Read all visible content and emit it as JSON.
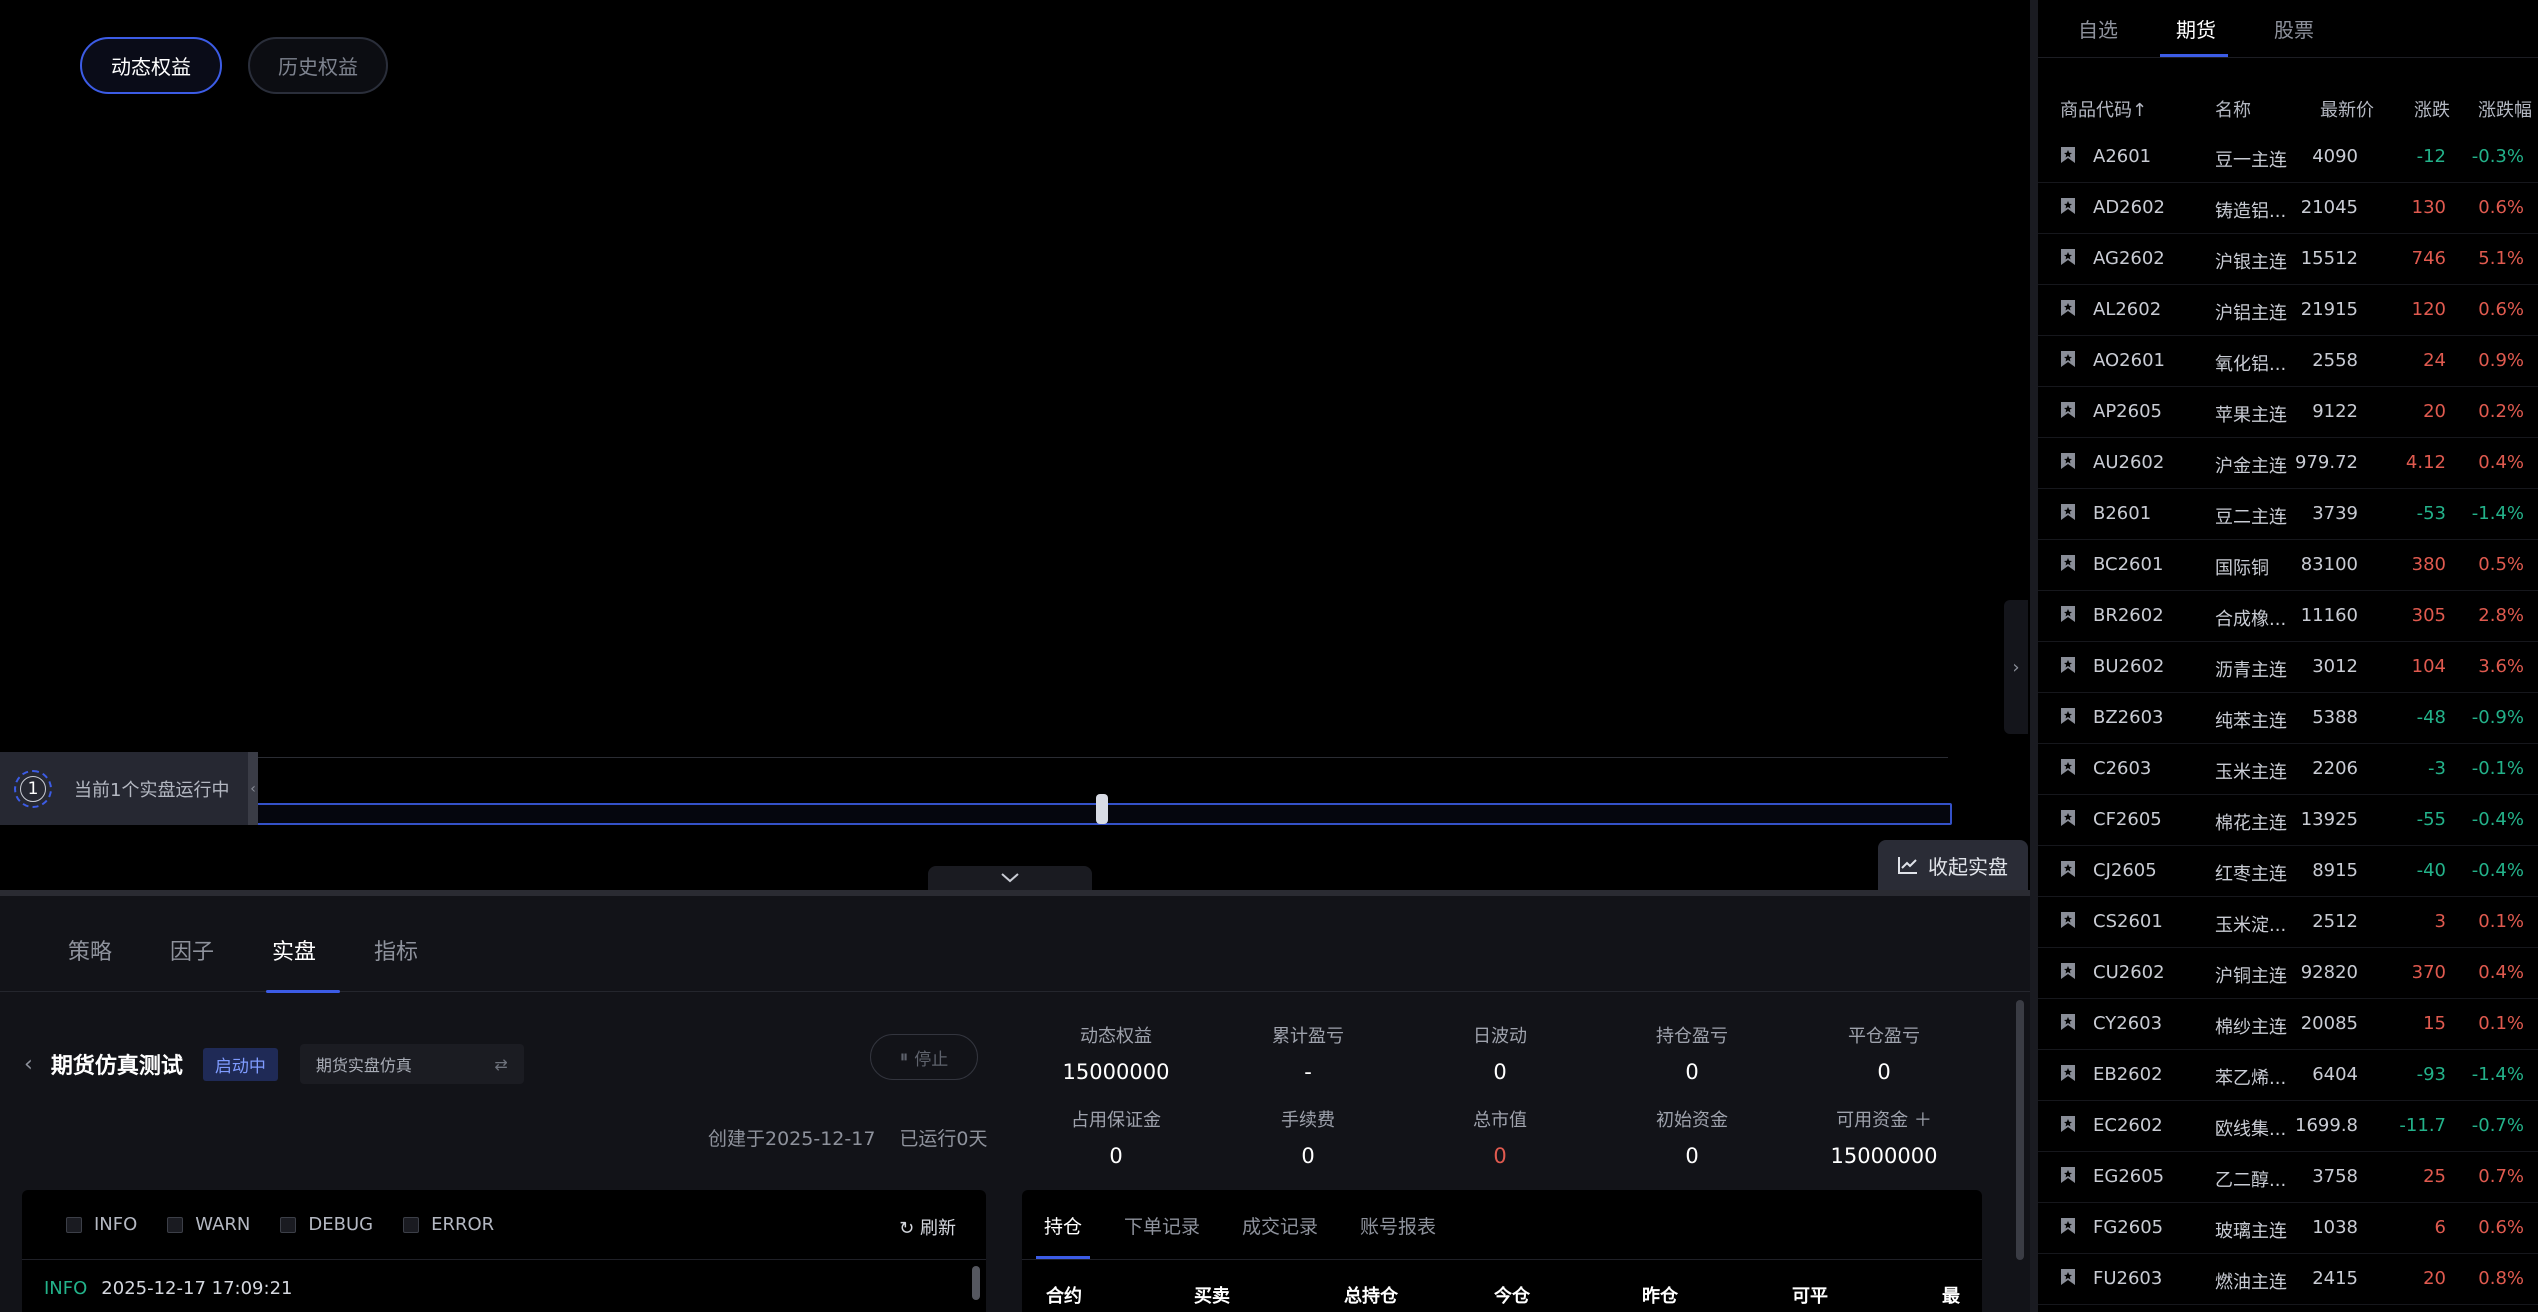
{
  "equity_toggle": {
    "dynamic": "动态权益",
    "history": "历史权益"
  },
  "running_info": {
    "count": "1",
    "text": "当前1个实盘运行中"
  },
  "collapse_button": "收起实盘",
  "bottom_tabs": [
    "策略",
    "因子",
    "实盘",
    "指标"
  ],
  "strategy": {
    "name": "期货仿真测试",
    "status": "启动中",
    "mode": "期货实盘仿真",
    "stop_label": "停止",
    "created": "创建于2025-12-17",
    "running_days": "已运行0天"
  },
  "stats": [
    {
      "label": "动态权益",
      "value": "15000000"
    },
    {
      "label": "累计盈亏",
      "value": "-"
    },
    {
      "label": "日波动",
      "value": "0"
    },
    {
      "label": "持仓盈亏",
      "value": "0"
    },
    {
      "label": "平仓盈亏",
      "value": "0"
    },
    {
      "label": "占用保证金",
      "value": "0"
    },
    {
      "label": "手续费",
      "value": "0"
    },
    {
      "label": "总市值",
      "value": "0",
      "color": "#e05a4f"
    },
    {
      "label": "初始资金",
      "value": "0"
    },
    {
      "label": "可用资金 ＋",
      "value": "15000000"
    }
  ],
  "log": {
    "filters": [
      "INFO",
      "WARN",
      "DEBUG",
      "ERROR"
    ],
    "refresh": "刷新",
    "entries": [
      {
        "level": "INFO",
        "time": "2025-12-17 17:09:21"
      }
    ]
  },
  "positions": {
    "tabs": [
      "持仓",
      "下单记录",
      "成交记录",
      "账号报表"
    ],
    "columns": [
      "合约",
      "买卖",
      "总持仓",
      "今仓",
      "昨仓",
      "可平",
      "最新"
    ]
  },
  "market": {
    "tabs": [
      "自选",
      "期货",
      "股票"
    ],
    "headers": [
      "商品代码↑",
      "名称",
      "最新价",
      "涨跌",
      "涨跌幅"
    ],
    "rows": [
      {
        "code": "A2601",
        "name": "豆一主连",
        "price": "4090",
        "change": "-12",
        "pct": "-0.3%",
        "dir": "down"
      },
      {
        "code": "AD2602",
        "name": "铸造铝...",
        "price": "21045",
        "change": "130",
        "pct": "0.6%",
        "dir": "up"
      },
      {
        "code": "AG2602",
        "name": "沪银主连",
        "price": "15512",
        "change": "746",
        "pct": "5.1%",
        "dir": "up"
      },
      {
        "code": "AL2602",
        "name": "沪铝主连",
        "price": "21915",
        "change": "120",
        "pct": "0.6%",
        "dir": "up"
      },
      {
        "code": "AO2601",
        "name": "氧化铝...",
        "price": "2558",
        "change": "24",
        "pct": "0.9%",
        "dir": "up"
      },
      {
        "code": "AP2605",
        "name": "苹果主连",
        "price": "9122",
        "change": "20",
        "pct": "0.2%",
        "dir": "up"
      },
      {
        "code": "AU2602",
        "name": "沪金主连",
        "price": "979.72",
        "change": "4.12",
        "pct": "0.4%",
        "dir": "up"
      },
      {
        "code": "B2601",
        "name": "豆二主连",
        "price": "3739",
        "change": "-53",
        "pct": "-1.4%",
        "dir": "down"
      },
      {
        "code": "BC2601",
        "name": "国际铜",
        "price": "83100",
        "change": "380",
        "pct": "0.5%",
        "dir": "up"
      },
      {
        "code": "BR2602",
        "name": "合成橡...",
        "price": "11160",
        "change": "305",
        "pct": "2.8%",
        "dir": "up"
      },
      {
        "code": "BU2602",
        "name": "沥青主连",
        "price": "3012",
        "change": "104",
        "pct": "3.6%",
        "dir": "up"
      },
      {
        "code": "BZ2603",
        "name": "纯苯主连",
        "price": "5388",
        "change": "-48",
        "pct": "-0.9%",
        "dir": "down"
      },
      {
        "code": "C2603",
        "name": "玉米主连",
        "price": "2206",
        "change": "-3",
        "pct": "-0.1%",
        "dir": "down"
      },
      {
        "code": "CF2605",
        "name": "棉花主连",
        "price": "13925",
        "change": "-55",
        "pct": "-0.4%",
        "dir": "down"
      },
      {
        "code": "CJ2605",
        "name": "红枣主连",
        "price": "8915",
        "change": "-40",
        "pct": "-0.4%",
        "dir": "down"
      },
      {
        "code": "CS2601",
        "name": "玉米淀...",
        "price": "2512",
        "change": "3",
        "pct": "0.1%",
        "dir": "up"
      },
      {
        "code": "CU2602",
        "name": "沪铜主连",
        "price": "92820",
        "change": "370",
        "pct": "0.4%",
        "dir": "up"
      },
      {
        "code": "CY2603",
        "name": "棉纱主连",
        "price": "20085",
        "change": "15",
        "pct": "0.1%",
        "dir": "up"
      },
      {
        "code": "EB2602",
        "name": "苯乙烯...",
        "price": "6404",
        "change": "-93",
        "pct": "-1.4%",
        "dir": "down"
      },
      {
        "code": "EC2602",
        "name": "欧线集...",
        "price": "1699.8",
        "change": "-11.7",
        "pct": "-0.7%",
        "dir": "down"
      },
      {
        "code": "EG2605",
        "name": "乙二醇...",
        "price": "3758",
        "change": "25",
        "pct": "0.7%",
        "dir": "up"
      },
      {
        "code": "FG2605",
        "name": "玻璃主连",
        "price": "1038",
        "change": "6",
        "pct": "0.6%",
        "dir": "up"
      },
      {
        "code": "FU2603",
        "name": "燃油主连",
        "price": "2415",
        "change": "20",
        "pct": "0.8%",
        "dir": "up"
      }
    ]
  }
}
